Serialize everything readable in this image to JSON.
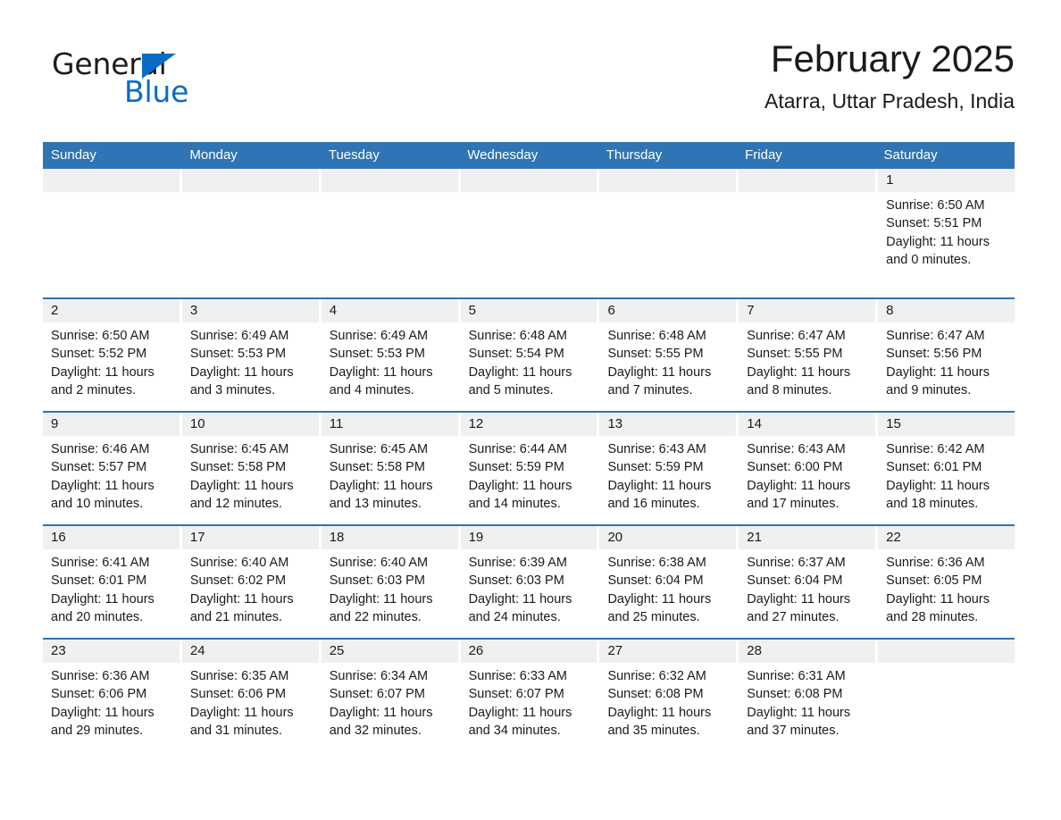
{
  "brand": {
    "word_one": "General",
    "word_two": "Blue",
    "accent_color": "#0a6cc4"
  },
  "header": {
    "title": "February 2025",
    "subtitle": "Atarra, Uttar Pradesh, India"
  },
  "theme": {
    "header_blue": "#2f74b5",
    "daynum_bg": "#f0f0f0",
    "text": "#1a1a1a"
  },
  "weekdays": [
    "Sunday",
    "Monday",
    "Tuesday",
    "Wednesday",
    "Thursday",
    "Friday",
    "Saturday"
  ],
  "weeks": [
    {
      "days": [
        {
          "date": "",
          "empty": true,
          "lines": []
        },
        {
          "date": "",
          "empty": true,
          "lines": []
        },
        {
          "date": "",
          "empty": true,
          "lines": []
        },
        {
          "date": "",
          "empty": true,
          "lines": []
        },
        {
          "date": "",
          "empty": true,
          "lines": []
        },
        {
          "date": "",
          "empty": true,
          "lines": []
        },
        {
          "date": "1",
          "empty": false,
          "lines": [
            "Sunrise: 6:50 AM",
            "Sunset: 5:51 PM",
            "Daylight: 11 hours",
            "and 0 minutes."
          ]
        }
      ]
    },
    {
      "days": [
        {
          "date": "2",
          "empty": false,
          "lines": [
            "Sunrise: 6:50 AM",
            "Sunset: 5:52 PM",
            "Daylight: 11 hours",
            "and 2 minutes."
          ]
        },
        {
          "date": "3",
          "empty": false,
          "lines": [
            "Sunrise: 6:49 AM",
            "Sunset: 5:53 PM",
            "Daylight: 11 hours",
            "and 3 minutes."
          ]
        },
        {
          "date": "4",
          "empty": false,
          "lines": [
            "Sunrise: 6:49 AM",
            "Sunset: 5:53 PM",
            "Daylight: 11 hours",
            "and 4 minutes."
          ]
        },
        {
          "date": "5",
          "empty": false,
          "lines": [
            "Sunrise: 6:48 AM",
            "Sunset: 5:54 PM",
            "Daylight: 11 hours",
            "and 5 minutes."
          ]
        },
        {
          "date": "6",
          "empty": false,
          "lines": [
            "Sunrise: 6:48 AM",
            "Sunset: 5:55 PM",
            "Daylight: 11 hours",
            "and 7 minutes."
          ]
        },
        {
          "date": "7",
          "empty": false,
          "lines": [
            "Sunrise: 6:47 AM",
            "Sunset: 5:55 PM",
            "Daylight: 11 hours",
            "and 8 minutes."
          ]
        },
        {
          "date": "8",
          "empty": false,
          "lines": [
            "Sunrise: 6:47 AM",
            "Sunset: 5:56 PM",
            "Daylight: 11 hours",
            "and 9 minutes."
          ]
        }
      ]
    },
    {
      "days": [
        {
          "date": "9",
          "empty": false,
          "lines": [
            "Sunrise: 6:46 AM",
            "Sunset: 5:57 PM",
            "Daylight: 11 hours",
            "and 10 minutes."
          ]
        },
        {
          "date": "10",
          "empty": false,
          "lines": [
            "Sunrise: 6:45 AM",
            "Sunset: 5:58 PM",
            "Daylight: 11 hours",
            "and 12 minutes."
          ]
        },
        {
          "date": "11",
          "empty": false,
          "lines": [
            "Sunrise: 6:45 AM",
            "Sunset: 5:58 PM",
            "Daylight: 11 hours",
            "and 13 minutes."
          ]
        },
        {
          "date": "12",
          "empty": false,
          "lines": [
            "Sunrise: 6:44 AM",
            "Sunset: 5:59 PM",
            "Daylight: 11 hours",
            "and 14 minutes."
          ]
        },
        {
          "date": "13",
          "empty": false,
          "lines": [
            "Sunrise: 6:43 AM",
            "Sunset: 5:59 PM",
            "Daylight: 11 hours",
            "and 16 minutes."
          ]
        },
        {
          "date": "14",
          "empty": false,
          "lines": [
            "Sunrise: 6:43 AM",
            "Sunset: 6:00 PM",
            "Daylight: 11 hours",
            "and 17 minutes."
          ]
        },
        {
          "date": "15",
          "empty": false,
          "lines": [
            "Sunrise: 6:42 AM",
            "Sunset: 6:01 PM",
            "Daylight: 11 hours",
            "and 18 minutes."
          ]
        }
      ]
    },
    {
      "days": [
        {
          "date": "16",
          "empty": false,
          "lines": [
            "Sunrise: 6:41 AM",
            "Sunset: 6:01 PM",
            "Daylight: 11 hours",
            "and 20 minutes."
          ]
        },
        {
          "date": "17",
          "empty": false,
          "lines": [
            "Sunrise: 6:40 AM",
            "Sunset: 6:02 PM",
            "Daylight: 11 hours",
            "and 21 minutes."
          ]
        },
        {
          "date": "18",
          "empty": false,
          "lines": [
            "Sunrise: 6:40 AM",
            "Sunset: 6:03 PM",
            "Daylight: 11 hours",
            "and 22 minutes."
          ]
        },
        {
          "date": "19",
          "empty": false,
          "lines": [
            "Sunrise: 6:39 AM",
            "Sunset: 6:03 PM",
            "Daylight: 11 hours",
            "and 24 minutes."
          ]
        },
        {
          "date": "20",
          "empty": false,
          "lines": [
            "Sunrise: 6:38 AM",
            "Sunset: 6:04 PM",
            "Daylight: 11 hours",
            "and 25 minutes."
          ]
        },
        {
          "date": "21",
          "empty": false,
          "lines": [
            "Sunrise: 6:37 AM",
            "Sunset: 6:04 PM",
            "Daylight: 11 hours",
            "and 27 minutes."
          ]
        },
        {
          "date": "22",
          "empty": false,
          "lines": [
            "Sunrise: 6:36 AM",
            "Sunset: 6:05 PM",
            "Daylight: 11 hours",
            "and 28 minutes."
          ]
        }
      ]
    },
    {
      "days": [
        {
          "date": "23",
          "empty": false,
          "lines": [
            "Sunrise: 6:36 AM",
            "Sunset: 6:06 PM",
            "Daylight: 11 hours",
            "and 29 minutes."
          ]
        },
        {
          "date": "24",
          "empty": false,
          "lines": [
            "Sunrise: 6:35 AM",
            "Sunset: 6:06 PM",
            "Daylight: 11 hours",
            "and 31 minutes."
          ]
        },
        {
          "date": "25",
          "empty": false,
          "lines": [
            "Sunrise: 6:34 AM",
            "Sunset: 6:07 PM",
            "Daylight: 11 hours",
            "and 32 minutes."
          ]
        },
        {
          "date": "26",
          "empty": false,
          "lines": [
            "Sunrise: 6:33 AM",
            "Sunset: 6:07 PM",
            "Daylight: 11 hours",
            "and 34 minutes."
          ]
        },
        {
          "date": "27",
          "empty": false,
          "lines": [
            "Sunrise: 6:32 AM",
            "Sunset: 6:08 PM",
            "Daylight: 11 hours",
            "and 35 minutes."
          ]
        },
        {
          "date": "28",
          "empty": false,
          "lines": [
            "Sunrise: 6:31 AM",
            "Sunset: 6:08 PM",
            "Daylight: 11 hours",
            "and 37 minutes."
          ]
        },
        {
          "date": "",
          "empty": true,
          "lines": []
        }
      ]
    }
  ]
}
